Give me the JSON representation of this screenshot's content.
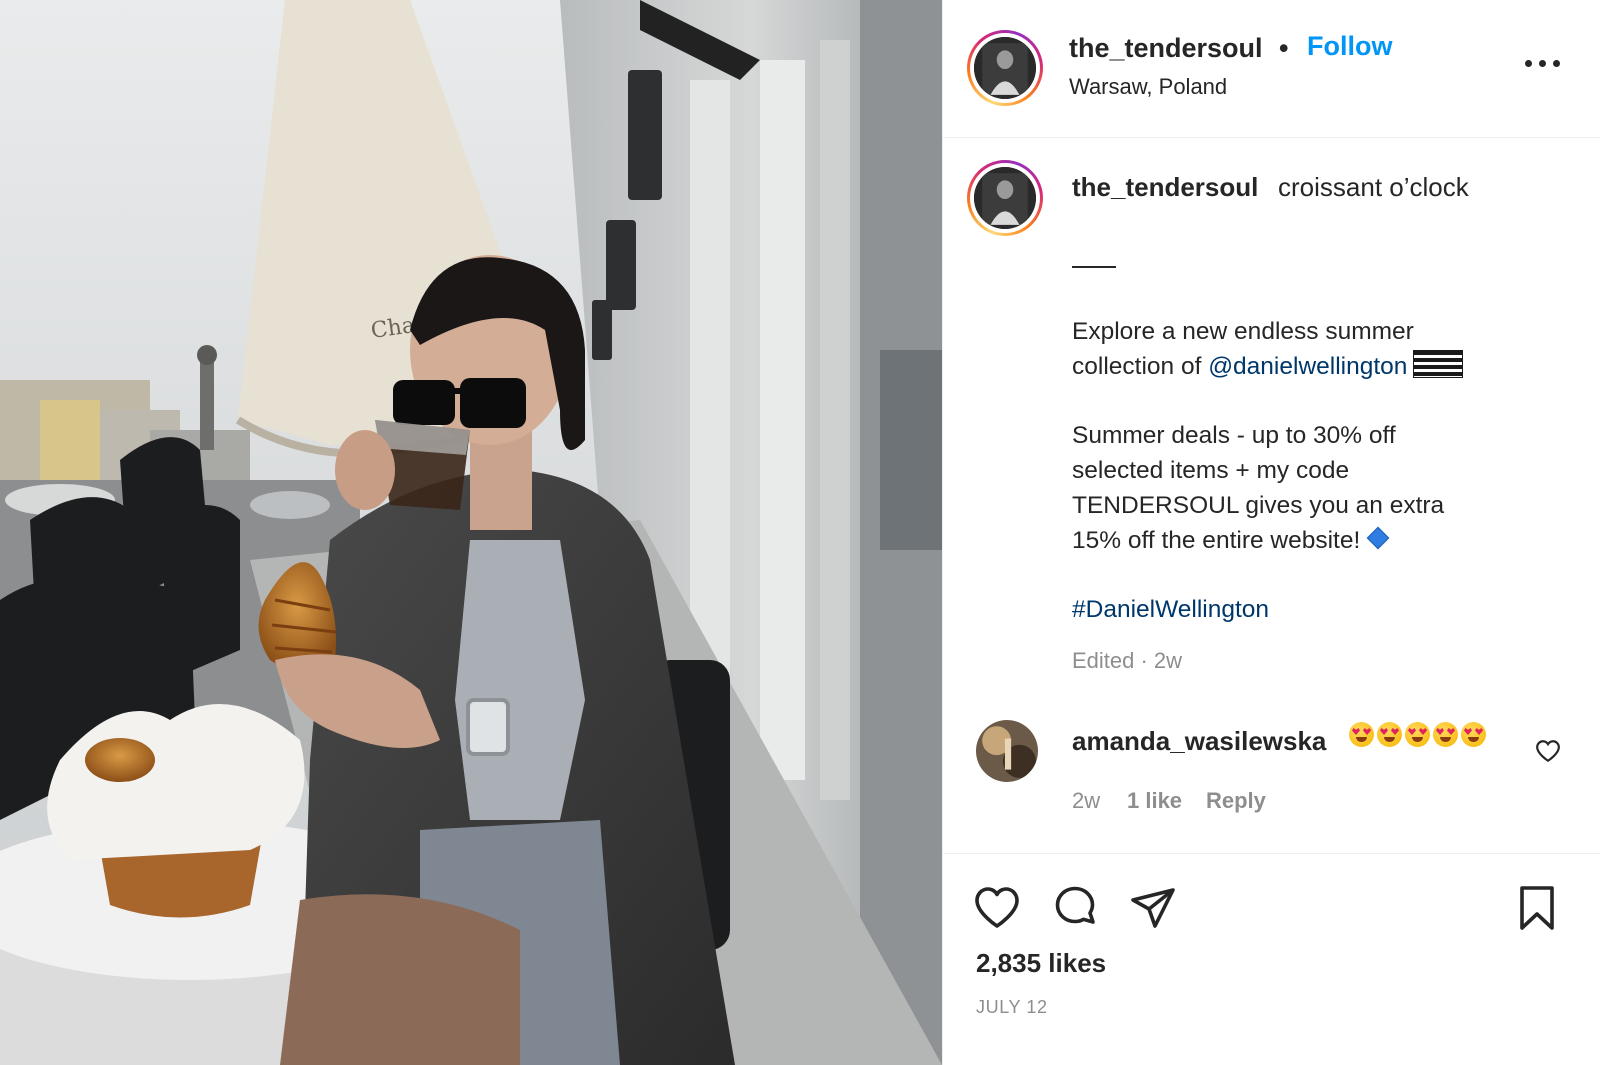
{
  "post": {
    "username": "the_tendersoul",
    "separator": "•",
    "follow_label": "Follow",
    "location": "Warsaw, Poland",
    "more_icon": "more-options-icon"
  },
  "caption": {
    "username": "the_tendersoul",
    "first_line": "croissant o’clock",
    "para1_line1": "Explore a new endless summer",
    "para1_line2_prefix": "collection of ",
    "mention": "@danielwellington",
    "flag_icon": "flag-icon",
    "para2_line1": "Summer deals - up to 30% off",
    "para2_line2": "selected items + my code",
    "para2_line3": "TENDERSOUL gives you an extra",
    "para2_line4": "15% off the entire website!",
    "diamond_icon": "blue-diamond-icon",
    "hashtag": "#DanielWellington",
    "meta": "Edited · 2w"
  },
  "comment": {
    "username": "amanda_wasilewska",
    "emoji_icon": "heart-eyes-emoji",
    "emoji_count": 5,
    "time": "2w",
    "likes": "1 like",
    "reply_label": "Reply"
  },
  "actions": {
    "like_icon": "heart-icon",
    "comment_icon": "comment-icon",
    "share_icon": "send-icon",
    "save_icon": "bookmark-icon"
  },
  "likes_count": "2,835 likes",
  "date": "JULY 12",
  "colors": {
    "follow_blue": "#0095f6",
    "link_blue": "#00376b",
    "muted_gray": "#8e8e8e",
    "text": "#262626"
  }
}
